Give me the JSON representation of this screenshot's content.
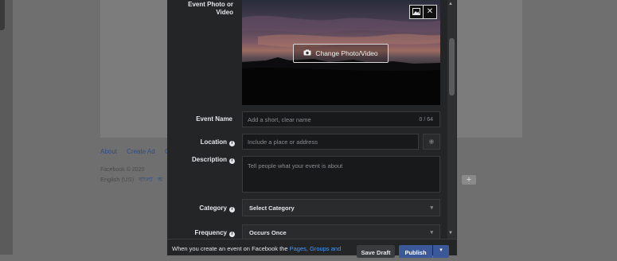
{
  "background": {
    "footer_links": [
      "About",
      "Create Ad",
      "C"
    ],
    "copyright": "Facebook © 2020",
    "language": "English (US)",
    "bangla": "বাংলা",
    "other_lang": "অ",
    "plus": "+"
  },
  "form": {
    "photo_label": "Event Photo or Video",
    "change_photo_label": "Change Photo/Video",
    "event_name_label": "Event Name",
    "event_name_placeholder": "Add a short, clear name",
    "event_name_counter": "0 / 64",
    "location_label": "Location",
    "location_placeholder": "Include a place or address",
    "description_label": "Description",
    "description_placeholder": "Tell people what your event is about",
    "category_label": "Category",
    "category_value": "Select Category",
    "frequency_label": "Frequency",
    "frequency_value": "Occurs Once"
  },
  "footer": {
    "note_prefix": "When you create an event on Facebook the ",
    "note_link": "Pages, Groups and",
    "save_draft": "Save Draft",
    "publish": "Publish"
  },
  "icons": {
    "camera": "camera-icon",
    "image": "image-icon",
    "close": "close-icon",
    "info": "info-icon",
    "chevron": "chevron-down-icon"
  }
}
